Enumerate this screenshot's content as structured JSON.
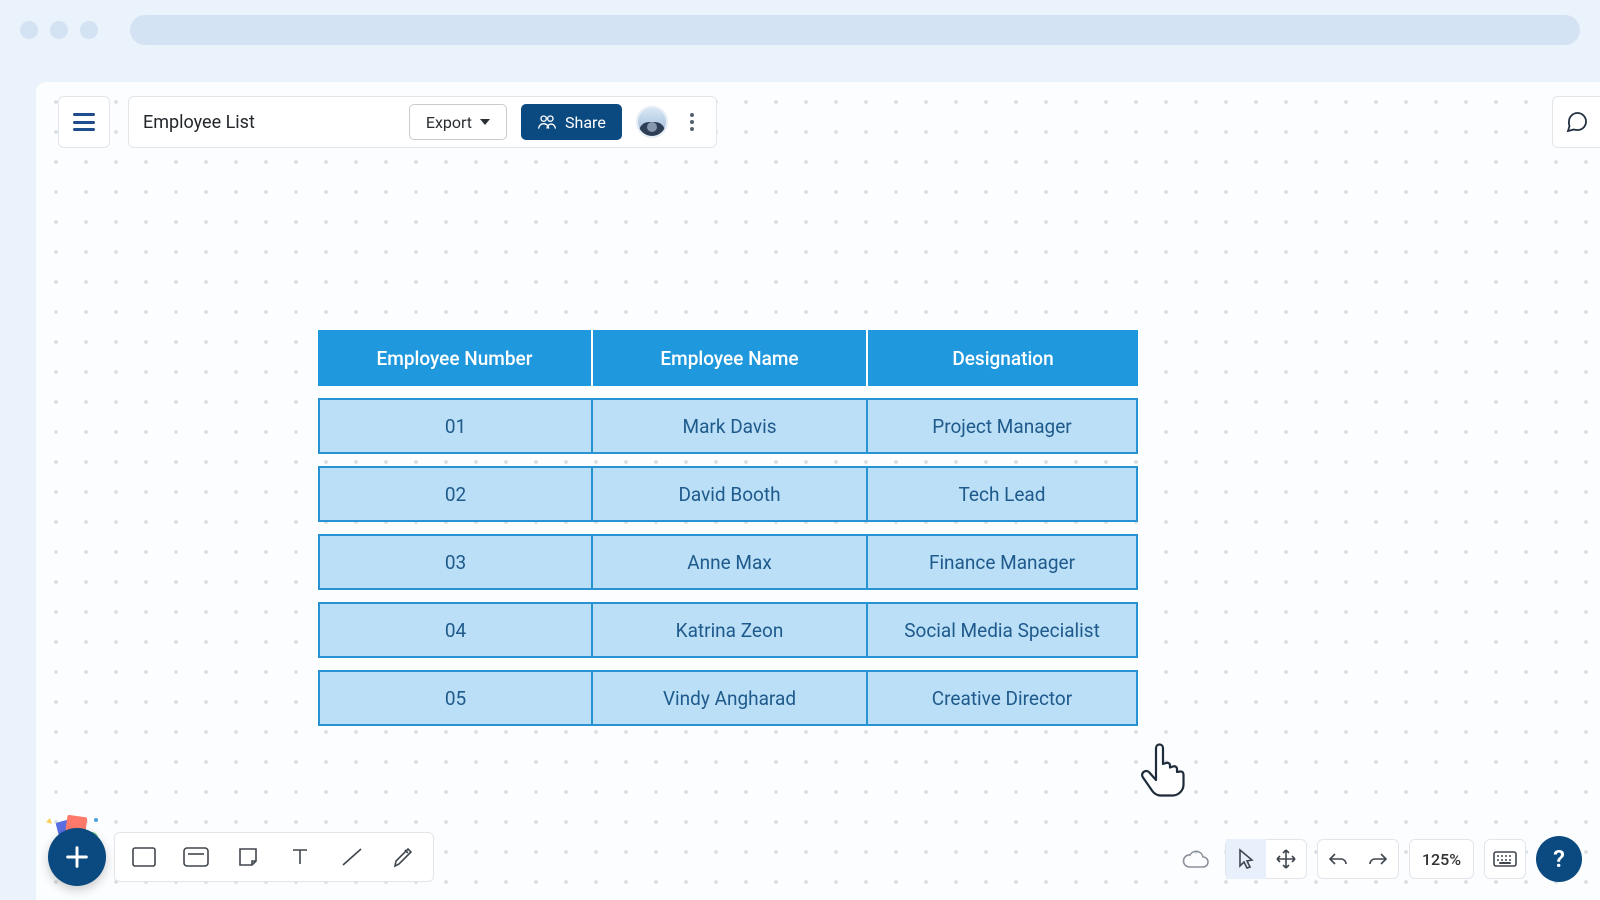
{
  "header": {
    "title": "Employee List",
    "export_label": "Export",
    "share_label": "Share"
  },
  "table": {
    "columns": [
      "Employee Number",
      "Employee Name",
      "Designation"
    ],
    "rows": [
      {
        "num": "01",
        "name": "Mark Davis",
        "role": "Project Manager"
      },
      {
        "num": "02",
        "name": "David Booth",
        "role": "Tech Lead"
      },
      {
        "num": "03",
        "name": "Anne Max",
        "role": "Finance Manager"
      },
      {
        "num": "04",
        "name": "Katrina Zeon",
        "role": "Social Media Specialist"
      },
      {
        "num": "05",
        "name": "Vindy Angharad",
        "role": "Creative Director"
      }
    ]
  },
  "footer": {
    "zoom": "125%"
  }
}
